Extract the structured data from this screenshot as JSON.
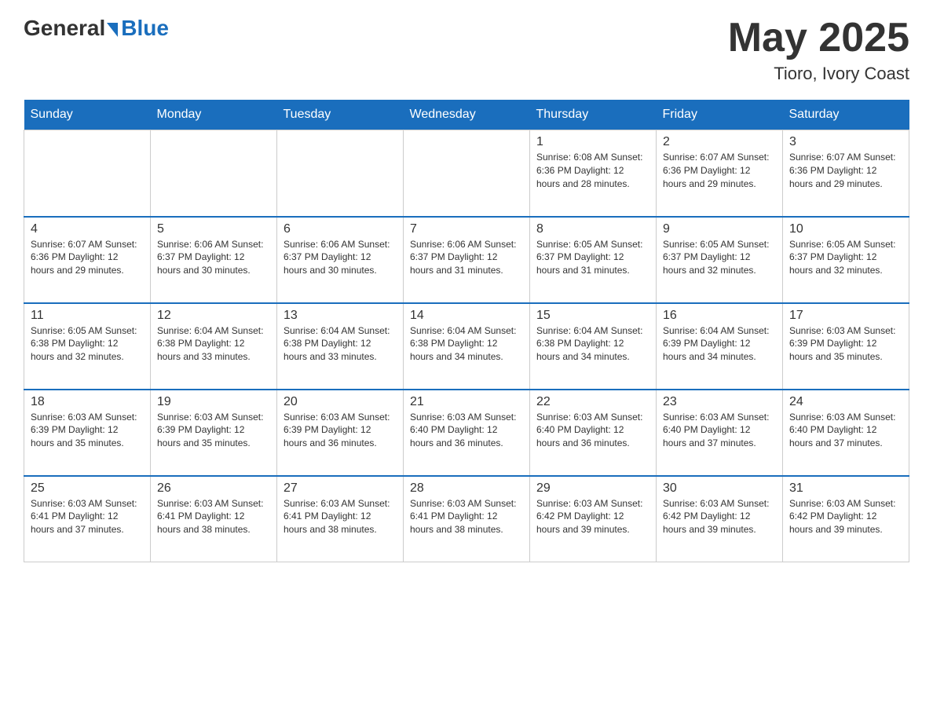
{
  "header": {
    "logo_general": "General",
    "logo_blue": "Blue",
    "month_title": "May 2025",
    "location": "Tioro, Ivory Coast"
  },
  "days_of_week": [
    "Sunday",
    "Monday",
    "Tuesday",
    "Wednesday",
    "Thursday",
    "Friday",
    "Saturday"
  ],
  "weeks": [
    [
      {
        "day": "",
        "info": ""
      },
      {
        "day": "",
        "info": ""
      },
      {
        "day": "",
        "info": ""
      },
      {
        "day": "",
        "info": ""
      },
      {
        "day": "1",
        "info": "Sunrise: 6:08 AM\nSunset: 6:36 PM\nDaylight: 12 hours and 28 minutes."
      },
      {
        "day": "2",
        "info": "Sunrise: 6:07 AM\nSunset: 6:36 PM\nDaylight: 12 hours and 29 minutes."
      },
      {
        "day": "3",
        "info": "Sunrise: 6:07 AM\nSunset: 6:36 PM\nDaylight: 12 hours and 29 minutes."
      }
    ],
    [
      {
        "day": "4",
        "info": "Sunrise: 6:07 AM\nSunset: 6:36 PM\nDaylight: 12 hours and 29 minutes."
      },
      {
        "day": "5",
        "info": "Sunrise: 6:06 AM\nSunset: 6:37 PM\nDaylight: 12 hours and 30 minutes."
      },
      {
        "day": "6",
        "info": "Sunrise: 6:06 AM\nSunset: 6:37 PM\nDaylight: 12 hours and 30 minutes."
      },
      {
        "day": "7",
        "info": "Sunrise: 6:06 AM\nSunset: 6:37 PM\nDaylight: 12 hours and 31 minutes."
      },
      {
        "day": "8",
        "info": "Sunrise: 6:05 AM\nSunset: 6:37 PM\nDaylight: 12 hours and 31 minutes."
      },
      {
        "day": "9",
        "info": "Sunrise: 6:05 AM\nSunset: 6:37 PM\nDaylight: 12 hours and 32 minutes."
      },
      {
        "day": "10",
        "info": "Sunrise: 6:05 AM\nSunset: 6:37 PM\nDaylight: 12 hours and 32 minutes."
      }
    ],
    [
      {
        "day": "11",
        "info": "Sunrise: 6:05 AM\nSunset: 6:38 PM\nDaylight: 12 hours and 32 minutes."
      },
      {
        "day": "12",
        "info": "Sunrise: 6:04 AM\nSunset: 6:38 PM\nDaylight: 12 hours and 33 minutes."
      },
      {
        "day": "13",
        "info": "Sunrise: 6:04 AM\nSunset: 6:38 PM\nDaylight: 12 hours and 33 minutes."
      },
      {
        "day": "14",
        "info": "Sunrise: 6:04 AM\nSunset: 6:38 PM\nDaylight: 12 hours and 34 minutes."
      },
      {
        "day": "15",
        "info": "Sunrise: 6:04 AM\nSunset: 6:38 PM\nDaylight: 12 hours and 34 minutes."
      },
      {
        "day": "16",
        "info": "Sunrise: 6:04 AM\nSunset: 6:39 PM\nDaylight: 12 hours and 34 minutes."
      },
      {
        "day": "17",
        "info": "Sunrise: 6:03 AM\nSunset: 6:39 PM\nDaylight: 12 hours and 35 minutes."
      }
    ],
    [
      {
        "day": "18",
        "info": "Sunrise: 6:03 AM\nSunset: 6:39 PM\nDaylight: 12 hours and 35 minutes."
      },
      {
        "day": "19",
        "info": "Sunrise: 6:03 AM\nSunset: 6:39 PM\nDaylight: 12 hours and 35 minutes."
      },
      {
        "day": "20",
        "info": "Sunrise: 6:03 AM\nSunset: 6:39 PM\nDaylight: 12 hours and 36 minutes."
      },
      {
        "day": "21",
        "info": "Sunrise: 6:03 AM\nSunset: 6:40 PM\nDaylight: 12 hours and 36 minutes."
      },
      {
        "day": "22",
        "info": "Sunrise: 6:03 AM\nSunset: 6:40 PM\nDaylight: 12 hours and 36 minutes."
      },
      {
        "day": "23",
        "info": "Sunrise: 6:03 AM\nSunset: 6:40 PM\nDaylight: 12 hours and 37 minutes."
      },
      {
        "day": "24",
        "info": "Sunrise: 6:03 AM\nSunset: 6:40 PM\nDaylight: 12 hours and 37 minutes."
      }
    ],
    [
      {
        "day": "25",
        "info": "Sunrise: 6:03 AM\nSunset: 6:41 PM\nDaylight: 12 hours and 37 minutes."
      },
      {
        "day": "26",
        "info": "Sunrise: 6:03 AM\nSunset: 6:41 PM\nDaylight: 12 hours and 38 minutes."
      },
      {
        "day": "27",
        "info": "Sunrise: 6:03 AM\nSunset: 6:41 PM\nDaylight: 12 hours and 38 minutes."
      },
      {
        "day": "28",
        "info": "Sunrise: 6:03 AM\nSunset: 6:41 PM\nDaylight: 12 hours and 38 minutes."
      },
      {
        "day": "29",
        "info": "Sunrise: 6:03 AM\nSunset: 6:42 PM\nDaylight: 12 hours and 39 minutes."
      },
      {
        "day": "30",
        "info": "Sunrise: 6:03 AM\nSunset: 6:42 PM\nDaylight: 12 hours and 39 minutes."
      },
      {
        "day": "31",
        "info": "Sunrise: 6:03 AM\nSunset: 6:42 PM\nDaylight: 12 hours and 39 minutes."
      }
    ]
  ]
}
